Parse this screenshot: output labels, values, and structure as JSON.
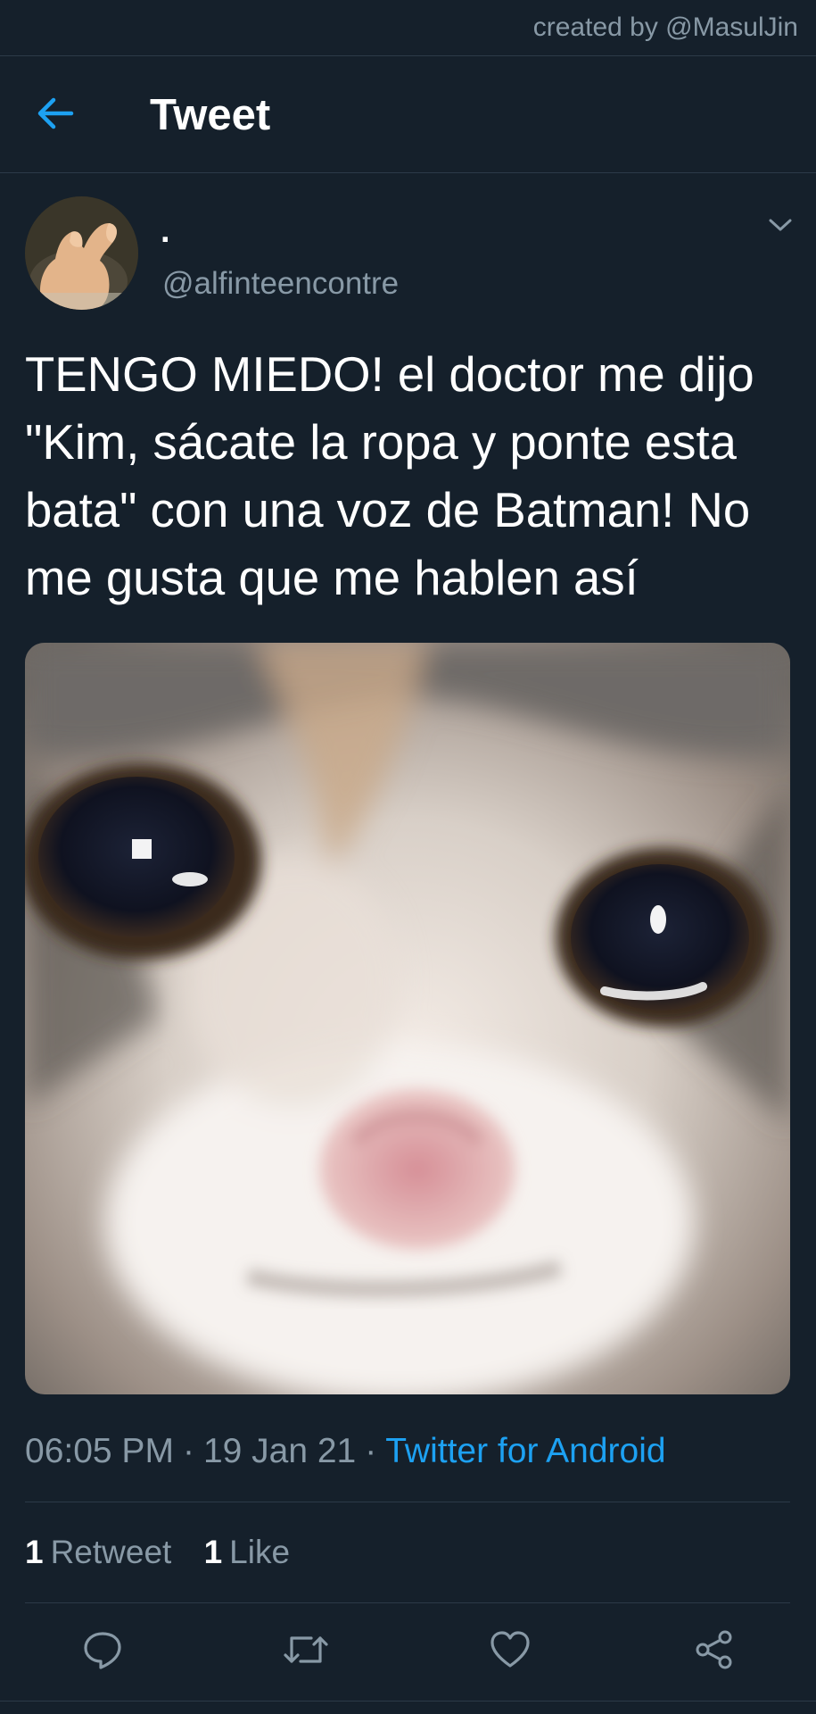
{
  "watermark": "created by @MasulJin",
  "header": {
    "title": "Tweet",
    "back_icon": "arrow-left-icon"
  },
  "tweet": {
    "display_name": ".",
    "handle": "@alfinteencontre",
    "text": "TENGO MIEDO! el doctor me dijo \"Kim, sácate la ropa y ponte esta bata\" con una voz de Batman! No me gusta que me hablen así",
    "time": "06:05 PM",
    "date": "19 Jan 21",
    "source": "Twitter for Android",
    "separator": "·",
    "retweets": {
      "count": "1",
      "label": "Retweet"
    },
    "likes": {
      "count": "1",
      "label": "Like"
    }
  },
  "actions": [
    "reply-icon",
    "retweet-icon",
    "like-icon",
    "share-icon"
  ],
  "colors": {
    "background": "#15202b",
    "accent": "#1da1f2",
    "secondary_text": "#8899a6",
    "divider": "#2c3a48"
  }
}
